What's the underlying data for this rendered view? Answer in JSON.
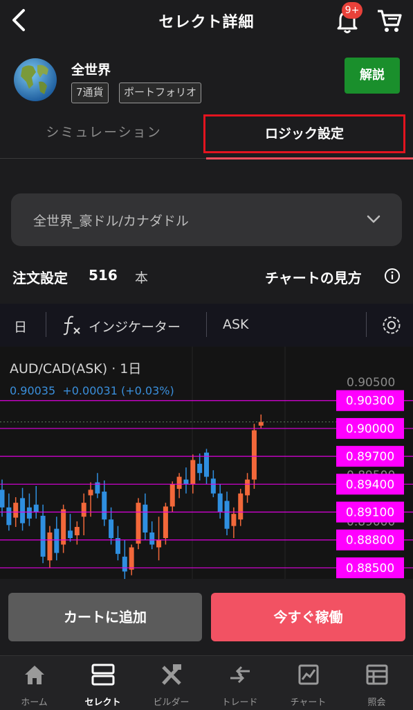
{
  "header": {
    "title": "セレクト詳細",
    "badge": "9+"
  },
  "portfolio": {
    "name": "全世界",
    "tags": [
      "7通貨",
      "ポートフォリオ"
    ],
    "explain_button": "解説"
  },
  "tabs": [
    "シミュレーション",
    "ロジック設定"
  ],
  "select": {
    "value": "全世界_豪ドル/カナダドル"
  },
  "order": {
    "label": "注文設定",
    "count": "516",
    "unit": "本",
    "howto": "チャートの見方"
  },
  "chart_toolbar": {
    "period": "日",
    "indicator": "インジケーター",
    "price_type": "ASK"
  },
  "chart": {
    "symbol": "AUD/CAD(ASK) · 1日",
    "quote": "0.90035  +0.00031 (+0.03%)",
    "axis_labels": [
      "0.90500",
      "0.89500",
      "0.89000"
    ],
    "order_lines": [
      "0.90300",
      "0.90000",
      "0.89700",
      "0.89400",
      "0.89100",
      "0.88800",
      "0.88500"
    ],
    "colors": {
      "up": "#f2683a",
      "down": "#2f8fe0",
      "line": "#e000e0",
      "label_bg": "#ff00ff"
    }
  },
  "chart_data": {
    "type": "candlestick",
    "y_range": [
      0.8838,
      0.9088
    ],
    "candles": [
      {
        "o": 0.8934,
        "h": 0.8945,
        "l": 0.8905,
        "c": 0.8915
      },
      {
        "o": 0.8915,
        "h": 0.893,
        "l": 0.889,
        "c": 0.8896
      },
      {
        "o": 0.8904,
        "h": 0.8926,
        "l": 0.8894,
        "c": 0.892
      },
      {
        "o": 0.8925,
        "h": 0.8936,
        "l": 0.889,
        "c": 0.8898
      },
      {
        "o": 0.8915,
        "h": 0.893,
        "l": 0.8895,
        "c": 0.8903
      },
      {
        "o": 0.8918,
        "h": 0.8938,
        "l": 0.8903,
        "c": 0.891
      },
      {
        "o": 0.8906,
        "h": 0.8918,
        "l": 0.8855,
        "c": 0.8862
      },
      {
        "o": 0.8858,
        "h": 0.8895,
        "l": 0.885,
        "c": 0.8888
      },
      {
        "o": 0.8892,
        "h": 0.8905,
        "l": 0.8858,
        "c": 0.8866
      },
      {
        "o": 0.8875,
        "h": 0.8918,
        "l": 0.8866,
        "c": 0.8913
      },
      {
        "o": 0.889,
        "h": 0.8908,
        "l": 0.8878,
        "c": 0.8882
      },
      {
        "o": 0.8885,
        "h": 0.89,
        "l": 0.8875,
        "c": 0.8894
      },
      {
        "o": 0.8905,
        "h": 0.893,
        "l": 0.8885,
        "c": 0.892
      },
      {
        "o": 0.8928,
        "h": 0.8942,
        "l": 0.8905,
        "c": 0.8934
      },
      {
        "o": 0.8942,
        "h": 0.8952,
        "l": 0.8925,
        "c": 0.893
      },
      {
        "o": 0.8932,
        "h": 0.8944,
        "l": 0.8895,
        "c": 0.8902
      },
      {
        "o": 0.8902,
        "h": 0.8915,
        "l": 0.8875,
        "c": 0.8882
      },
      {
        "o": 0.8882,
        "h": 0.8895,
        "l": 0.8858,
        "c": 0.8865
      },
      {
        "o": 0.8862,
        "h": 0.888,
        "l": 0.8838,
        "c": 0.8846
      },
      {
        "o": 0.8848,
        "h": 0.8875,
        "l": 0.8842,
        "c": 0.8872
      },
      {
        "o": 0.8876,
        "h": 0.8925,
        "l": 0.887,
        "c": 0.892
      },
      {
        "o": 0.8918,
        "h": 0.893,
        "l": 0.888,
        "c": 0.8888
      },
      {
        "o": 0.8888,
        "h": 0.89,
        "l": 0.887,
        "c": 0.8875
      },
      {
        "o": 0.8872,
        "h": 0.8905,
        "l": 0.8858,
        "c": 0.888
      },
      {
        "o": 0.8882,
        "h": 0.892,
        "l": 0.8875,
        "c": 0.8916
      },
      {
        "o": 0.8916,
        "h": 0.8943,
        "l": 0.891,
        "c": 0.894
      },
      {
        "o": 0.8935,
        "h": 0.8952,
        "l": 0.8925,
        "c": 0.8948
      },
      {
        "o": 0.8945,
        "h": 0.8958,
        "l": 0.893,
        "c": 0.894
      },
      {
        "o": 0.894,
        "h": 0.8972,
        "l": 0.893,
        "c": 0.8966
      },
      {
        "o": 0.8962,
        "h": 0.8973,
        "l": 0.8944,
        "c": 0.8952
      },
      {
        "o": 0.8974,
        "h": 0.8978,
        "l": 0.894,
        "c": 0.8948
      },
      {
        "o": 0.8946,
        "h": 0.8955,
        "l": 0.8926,
        "c": 0.893
      },
      {
        "o": 0.893,
        "h": 0.894,
        "l": 0.8903,
        "c": 0.891
      },
      {
        "o": 0.8922,
        "h": 0.8932,
        "l": 0.8885,
        "c": 0.8892
      },
      {
        "o": 0.8895,
        "h": 0.8915,
        "l": 0.8882,
        "c": 0.8908
      },
      {
        "o": 0.8902,
        "h": 0.8935,
        "l": 0.8895,
        "c": 0.893
      },
      {
        "o": 0.8928,
        "h": 0.8952,
        "l": 0.892,
        "c": 0.8945
      },
      {
        "o": 0.8945,
        "h": 0.9005,
        "l": 0.8935,
        "c": 0.8998
      },
      {
        "o": 0.9003,
        "h": 0.9015,
        "l": 0.9,
        "c": 0.9007
      }
    ]
  },
  "actions": {
    "add_cart": "カートに追加",
    "run_now": "今すぐ稼働"
  },
  "nav": [
    {
      "label": "ホーム",
      "icon": "home-icon"
    },
    {
      "label": "セレクト",
      "icon": "select-icon"
    },
    {
      "label": "ビルダー",
      "icon": "builder-icon"
    },
    {
      "label": "トレード",
      "icon": "trade-icon"
    },
    {
      "label": "チャート",
      "icon": "chart-icon"
    },
    {
      "label": "照会",
      "icon": "inquiry-icon"
    }
  ]
}
